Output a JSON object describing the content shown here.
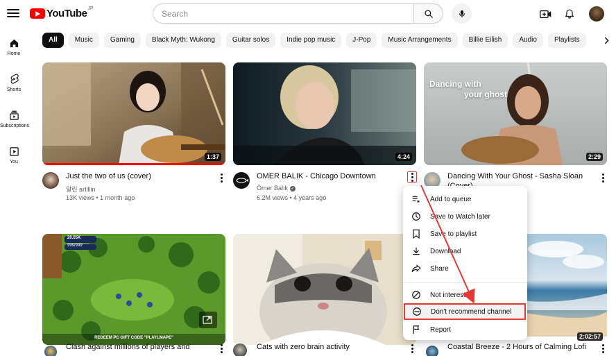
{
  "header": {
    "logo_text": "YouTube",
    "region": "JP",
    "search_placeholder": "Search"
  },
  "sidebar": {
    "items": [
      {
        "label": "Home",
        "icon": "home-icon"
      },
      {
        "label": "Shorts",
        "icon": "shorts-icon"
      },
      {
        "label": "Subscriptions",
        "icon": "subscriptions-icon"
      },
      {
        "label": "You",
        "icon": "you-icon"
      }
    ]
  },
  "chips": [
    "All",
    "Music",
    "Gaming",
    "Black Myth: Wukong",
    "Guitar solos",
    "Indie pop music",
    "J-Pop",
    "Music Arrangements",
    "Billie Eilish",
    "Audio",
    "Playlists"
  ],
  "videos": [
    {
      "title": "Just the two of us (cover)",
      "channel": "알린 arIlllin",
      "meta": "13K views • 1 month ago",
      "duration": "1:37"
    },
    {
      "title": "OMER BALIK - Chicago Downtown",
      "channel": "Ömer Balık",
      "meta": "6.2M views • 4 years ago",
      "duration": "4:24",
      "verified": true
    },
    {
      "title": "Dancing With Your Ghost - Sasha Sloan",
      "title_line2": "(Cover)",
      "overlay_line1": "Dancing with",
      "overlay_line2": "your ghost",
      "duration": "2:29"
    },
    {
      "title": "Clash against millions of players and",
      "thumb_text": "REDEEM PC GIFT CODE \"PLAYLMAPE\"",
      "hud_value": "20.05K",
      "hud_sub": "999/999"
    },
    {
      "title": "Cats with zero brain activity"
    },
    {
      "title": "Coastal Breeze - 2 Hours of Calming Lofi",
      "duration": "2:02:57"
    }
  ],
  "context_menu": {
    "items": [
      {
        "label": "Add to queue",
        "icon": "add-to-queue-icon"
      },
      {
        "label": "Save to Watch later",
        "icon": "clock-icon"
      },
      {
        "label": "Save to playlist",
        "icon": "bookmark-icon"
      },
      {
        "label": "Download",
        "icon": "download-icon"
      },
      {
        "label": "Share",
        "icon": "share-icon"
      },
      {
        "label": "Not interested",
        "icon": "not-interested-icon"
      },
      {
        "label": "Don't recommend channel",
        "icon": "minus-circle-icon"
      },
      {
        "label": "Report",
        "icon": "flag-icon"
      }
    ],
    "selected_label": "Don't recommend channel"
  },
  "colors": {
    "brand_red": "#ff0000",
    "annotation_red": "#e53935",
    "chip_bg": "#f2f2f2",
    "secondary_text": "#606060"
  }
}
